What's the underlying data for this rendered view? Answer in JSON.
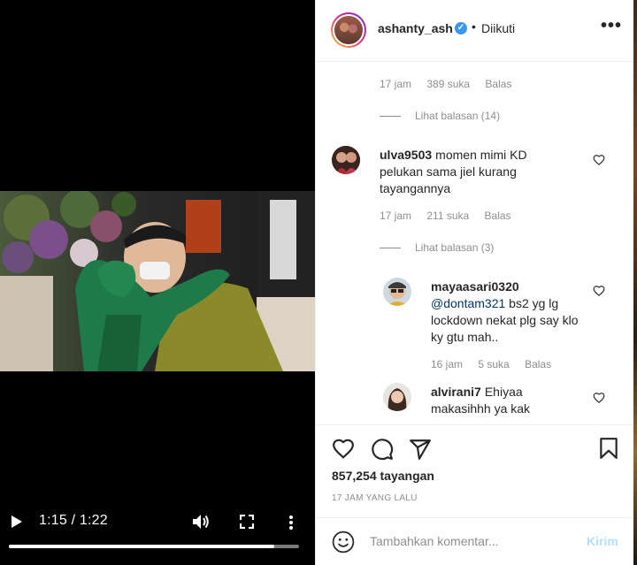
{
  "video": {
    "current_time": "1:15",
    "duration": "1:22",
    "time_display": "1:15 / 1:22",
    "progress": 0.915
  },
  "header": {
    "username": "ashanty_ash",
    "separator": "•",
    "follow_status": "Diikuti",
    "more": "•••"
  },
  "comments": {
    "top_meta": {
      "time": "17 jam",
      "likes": "389 suka",
      "reply": "Balas"
    },
    "top_replies": "Lihat balasan (14)",
    "items": [
      {
        "username": "ulva9503",
        "text": "momen mimi KD pelukan sama jiel kurang tayangannya",
        "time": "17 jam",
        "likes": "211 suka",
        "reply": "Balas",
        "view_replies": "Lihat balasan (3)"
      }
    ],
    "replies": [
      {
        "username": "mayaasari0320",
        "mention": "@dontam321",
        "text": " bs2 yg lg lockdown nekat plg say klo ky gtu mah..",
        "time": "16 jam",
        "likes": "5 suka",
        "reply": "Balas"
      },
      {
        "username": "alvirani7",
        "text": "Ehiyaa makasihhh ya kak"
      }
    ]
  },
  "actions": {
    "views": "857,254 tayangan",
    "posted_ago": "17 JAM YANG LALU"
  },
  "add_comment": {
    "placeholder": "Tambahkan komentar...",
    "send": "Kirim"
  },
  "colors": {
    "link": "#00376b",
    "muted": "#8e8e8e",
    "verified": "#3897f0",
    "send_disabled": "#b2dffc"
  }
}
